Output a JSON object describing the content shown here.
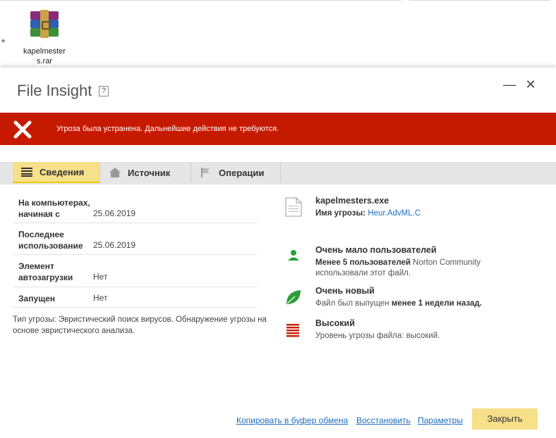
{
  "desktop": {
    "file_label": "kapelmesters.rar",
    "file_icon": "winrar-archive-icon"
  },
  "dialog": {
    "title": "File Insight",
    "help_label": "?",
    "minimize_label": "—",
    "close_label": "✕"
  },
  "banner": {
    "text": "Угроза была устранена. Дальнейшие действия не требуются.",
    "color": "#c61a00"
  },
  "tabs": [
    {
      "label": "Сведения",
      "icon": "details-icon",
      "active": true
    },
    {
      "label": "Источник",
      "icon": "home-icon",
      "active": false
    },
    {
      "label": "Операции",
      "icon": "flag-icon",
      "active": false
    }
  ],
  "details": [
    {
      "label_line1": "На компьютерах,",
      "label_line2": "начиная с",
      "value": "25.06.2019"
    },
    {
      "label_line1": "Последнее",
      "label_line2": "использование",
      "value": "25.06.2019"
    },
    {
      "label_line1": "Элемент",
      "label_line2": "автозагрузки",
      "value": "Нет"
    },
    {
      "label_line1": "Запущен",
      "label_line2": "",
      "value": "Нет"
    }
  ],
  "threat_type_note": "Тип угрозы: Эвристический поиск вирусов. Обнаружение угрозы на основе эвристического анализа.",
  "file": {
    "name": "kapelmesters.exe",
    "threat_label": "Имя угрозы:",
    "threat_name": "Heur.AdvML.C"
  },
  "insights": [
    {
      "icon": "user-icon",
      "title": "Очень мало пользователей",
      "bold": "Менее 5 пользователей",
      "text": " Norton Community использовали этот файл."
    },
    {
      "icon": "leaf-icon",
      "title": "Очень новый",
      "text_before": "Файл был выпущен ",
      "bold": "менее 1 недели назад."
    },
    {
      "icon": "threat-level-icon",
      "title": "Высокий",
      "text": "Уровень угрозы файла: высокий."
    }
  ],
  "footer": {
    "copy_link": "Копировать в буфер обмена",
    "restore_link": "Восстановить",
    "params_link": "Параметры",
    "close_button": "Закрыть"
  },
  "colors": {
    "accent_yellow": "#f7e08a",
    "link": "#1e6fbf",
    "green_icon": "#2e9e3a"
  }
}
